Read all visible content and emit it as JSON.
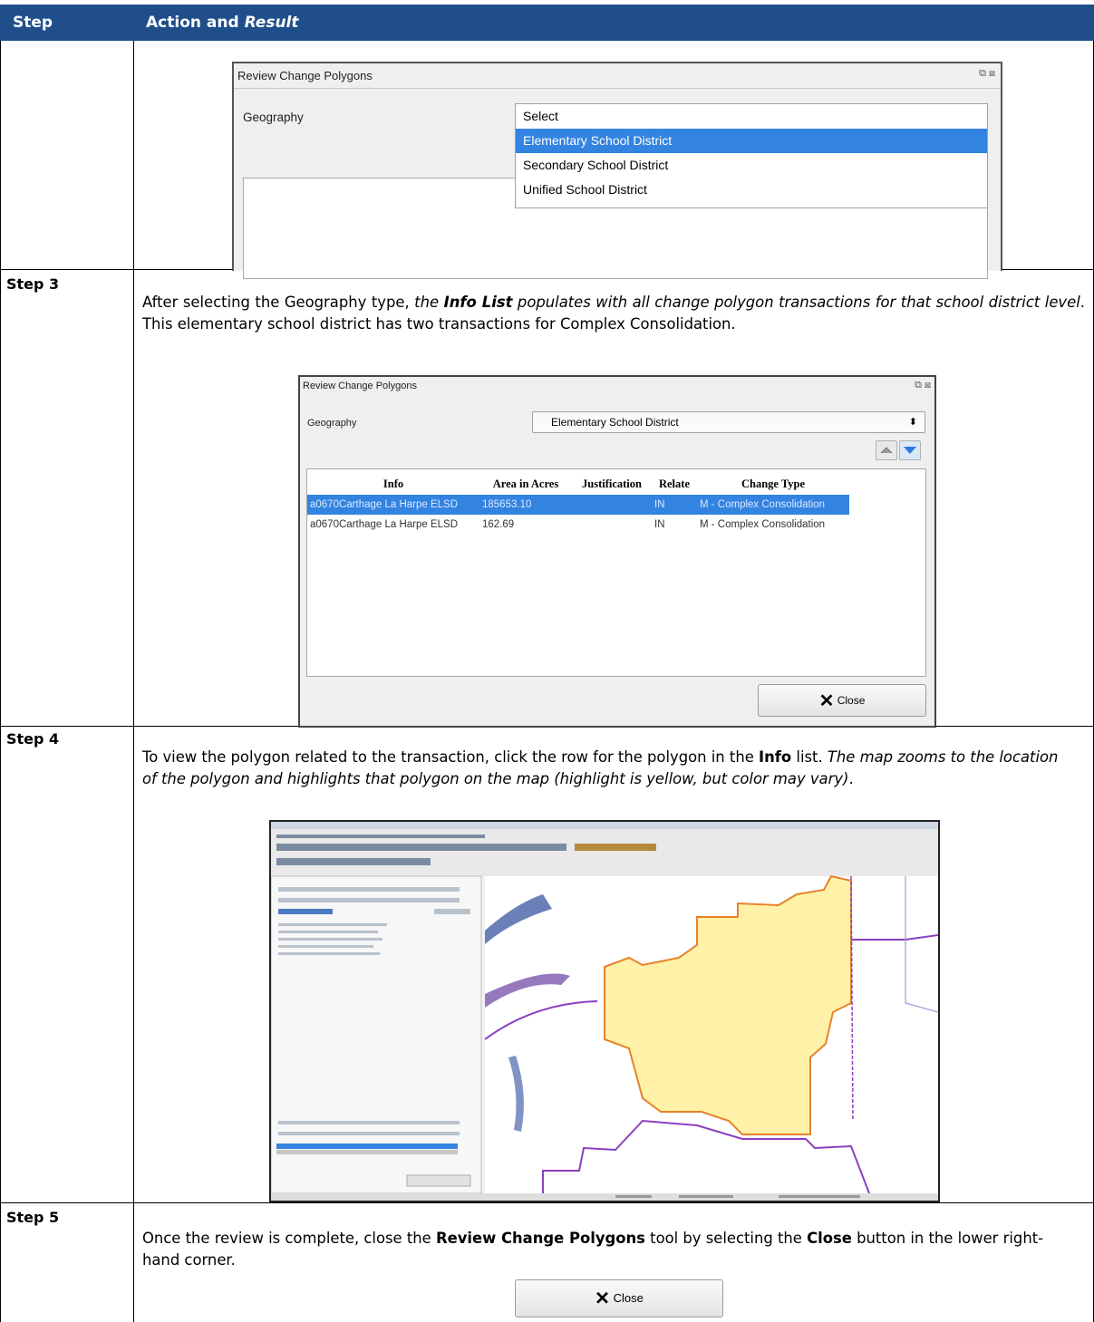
{
  "header": {
    "col_step": "Step",
    "col_action": "Action and ",
    "col_action_italic": "Result"
  },
  "rows": {
    "row0": {
      "dialog_title": "Review Change Polygons",
      "geography_label": "Geography",
      "dropdown_options": [
        "Select",
        "Elementary School District",
        "Secondary School District",
        "Unified School District"
      ],
      "selected_option_index": 1
    },
    "step3": {
      "label": "Step 3",
      "text_a": "After selecting the Geography type, ",
      "text_b": "the ",
      "text_c": "Info List",
      "text_d": " populates with all change polygon transactions for that school district level",
      "text_e": ". This elementary school district has two transactions for Complex Consolidation.",
      "dialog_title": "Review Change Polygons",
      "geography_label": "Geography",
      "geography_value": "Elementary School District",
      "columns": [
        "Info",
        "Area in Acres",
        "Justification",
        "Relate",
        "Change Type"
      ],
      "table_rows": [
        {
          "info": "a0670Carthage La Harpe ELSD",
          "area": "185653.10",
          "justification": "",
          "relate": "IN",
          "change_type": "M - Complex Consolidation"
        },
        {
          "info": "a0670Carthage La Harpe ELSD",
          "area": "162.69",
          "justification": "",
          "relate": "IN",
          "change_type": "M - Complex Consolidation"
        }
      ],
      "close_label": "Close"
    },
    "step4": {
      "label": "Step 4",
      "text_a": "To view the polygon related to the transaction, click the row for the polygon in the ",
      "text_b": "Info",
      "text_c": " list. ",
      "text_d": "The map zooms to the location of the polygon and highlights that polygon on the map (highlight is yellow, but color may vary)",
      "text_e": "."
    },
    "step5": {
      "label": "Step 5",
      "text_a": "Once the review is complete, close the ",
      "text_b": "Review Change Polygons",
      "text_c": " tool by selecting the ",
      "text_d": "Close",
      "text_e": " button in the lower right-hand corner.",
      "close_label": "Close"
    }
  },
  "colors": {
    "header_bg": "#1f4e8a",
    "selection": "#3383e0",
    "highlight_polygon": "#fff2a8",
    "boundary_orange": "#e8822a",
    "boundary_purple": "#8a3fc0",
    "river": "#5b6fa8"
  }
}
